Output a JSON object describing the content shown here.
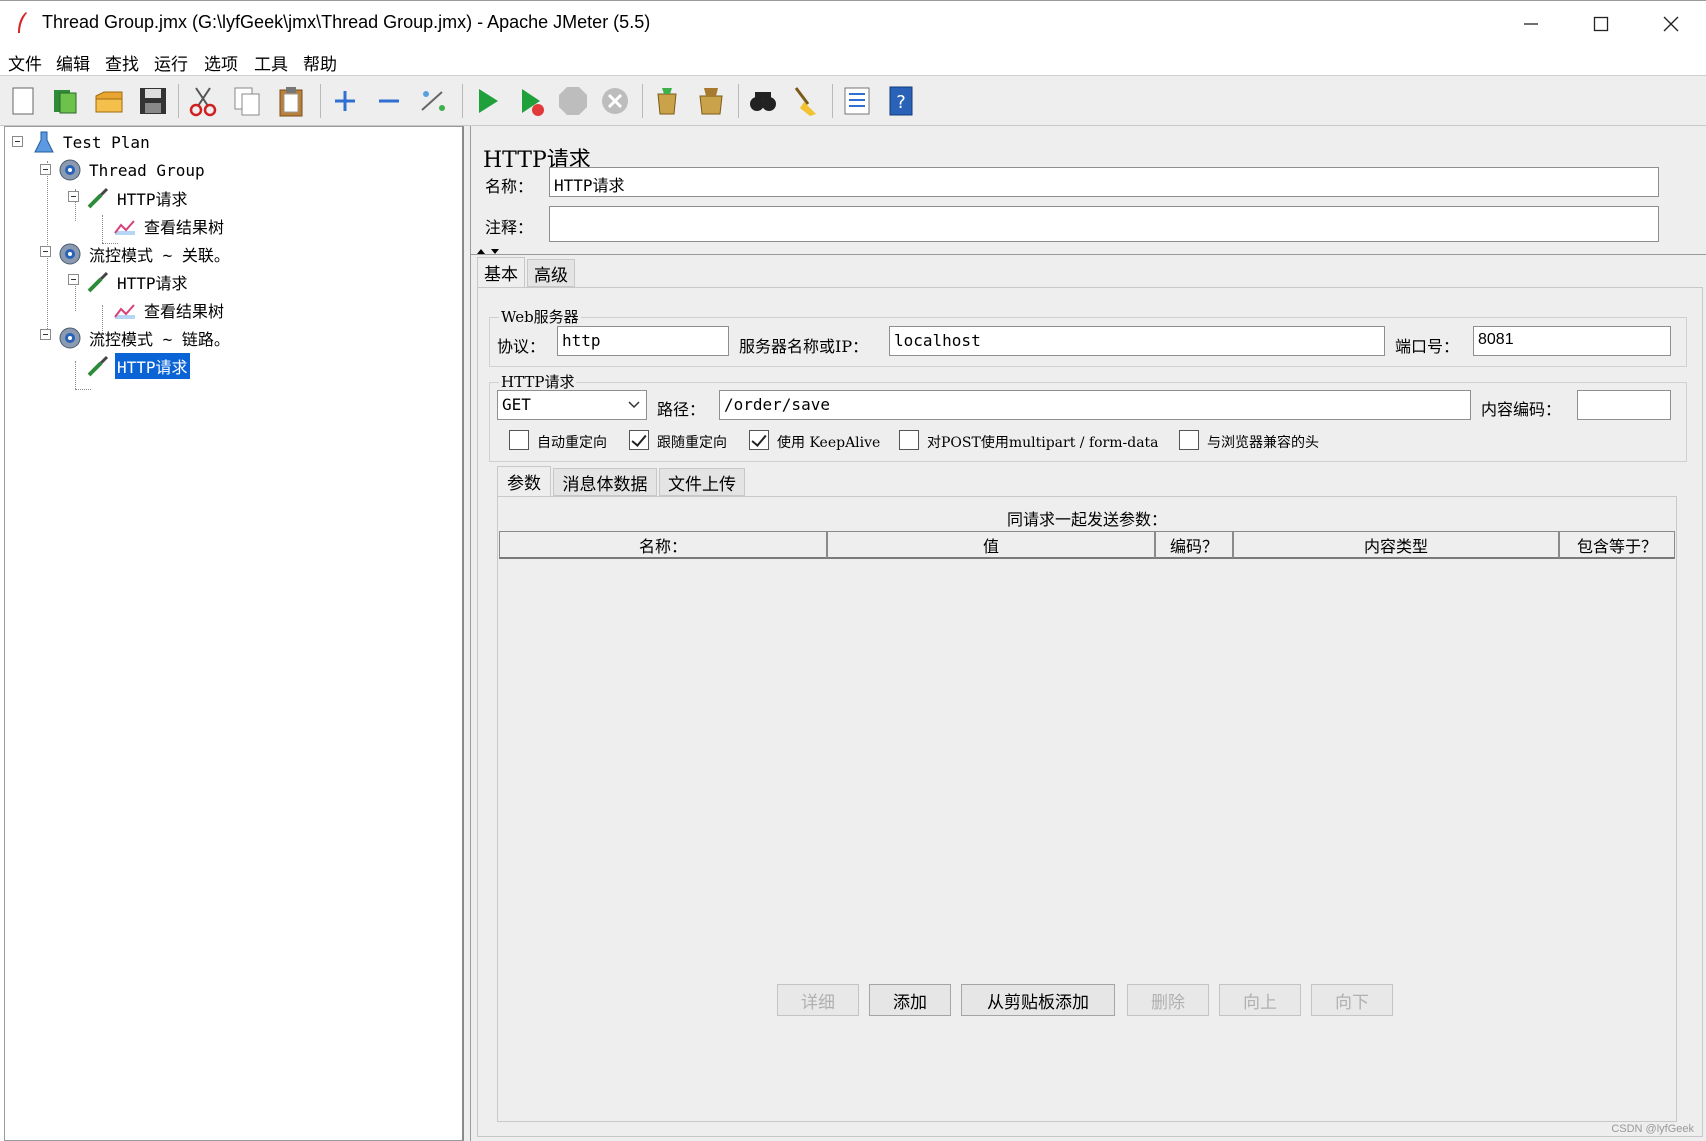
{
  "window": {
    "title": "Thread Group.jmx (G:\\lyfGeek\\jmx\\Thread Group.jmx) - Apache JMeter (5.5)"
  },
  "menu": [
    "文件",
    "编辑",
    "查找",
    "运行",
    "选项",
    "工具",
    "帮助"
  ],
  "toolbar": {
    "icons": [
      "new-icon",
      "templates-icon",
      "open-icon",
      "save-icon",
      "cut-icon",
      "copy-icon",
      "paste-icon",
      "expand-icon",
      "collapse-icon",
      "toggle-icon",
      "start-icon",
      "start-no-pause-icon",
      "stop-icon",
      "shutdown-icon",
      "clear-icon",
      "clear-all-icon",
      "search-icon",
      "reset-search-icon",
      "function-helper-icon",
      "help-icon"
    ]
  },
  "tree": {
    "nodes": [
      {
        "label": "Test Plan",
        "icon": "test-plan-icon"
      },
      {
        "label": "Thread Group",
        "icon": "thread-group-gear-icon"
      },
      {
        "label": "HTTP请求",
        "icon": "http-sampler-pipette-icon"
      },
      {
        "label": "查看结果树",
        "icon": "results-tree-graph-icon"
      },
      {
        "label": "流控模式 ~ 关联。",
        "icon": "thread-group-gear-icon"
      },
      {
        "label": "HTTP请求",
        "icon": "http-sampler-pipette-icon"
      },
      {
        "label": "查看结果树",
        "icon": "results-tree-graph-icon"
      },
      {
        "label": "流控模式 ~ 链路。",
        "icon": "thread-group-gear-icon"
      },
      {
        "label": "HTTP请求",
        "icon": "http-sampler-pipette-icon",
        "selected": true
      }
    ]
  },
  "panel": {
    "title": "HTTP请求",
    "name_label": "名称：",
    "name_value": "HTTP请求",
    "comment_label": "注释：",
    "comment_value": "",
    "tabs": [
      "基本",
      "高级"
    ],
    "web_server": {
      "legend": "Web服务器",
      "protocol_label": "协议：",
      "protocol_value": "http",
      "server_label": "服务器名称或IP：",
      "server_value": "localhost",
      "port_label": "端口号：",
      "port_value": "8081"
    },
    "http_request": {
      "legend": "HTTP请求",
      "method": "GET",
      "path_label": "路径：",
      "path_value": "/order/save",
      "encoding_label": "内容编码：",
      "encoding_value": ""
    },
    "checkboxes": [
      {
        "label": "自动重定向",
        "checked": false
      },
      {
        "label": "跟随重定向",
        "checked": true
      },
      {
        "label": "使用 KeepAlive",
        "checked": true
      },
      {
        "label": "对POST使用multipart / form-data",
        "checked": false
      },
      {
        "label": "与浏览器兼容的头",
        "checked": false
      }
    ],
    "subtabs": [
      "参数",
      "消息体数据",
      "文件上传"
    ],
    "params_caption": "同请求一起发送参数：",
    "columns": [
      "名称：",
      "值",
      "编码？",
      "内容类型",
      "包含等于？"
    ],
    "buttons": [
      {
        "label": "详细",
        "enabled": false
      },
      {
        "label": "添加",
        "enabled": true
      },
      {
        "label": "从剪贴板添加",
        "enabled": true
      },
      {
        "label": "删除",
        "enabled": false
      },
      {
        "label": "向上",
        "enabled": false
      },
      {
        "label": "向下",
        "enabled": false
      }
    ]
  },
  "watermark": "CSDN @lyfGeek",
  "colors": {
    "selection": "#0a64d6",
    "panel_bg": "#eeeeee"
  }
}
